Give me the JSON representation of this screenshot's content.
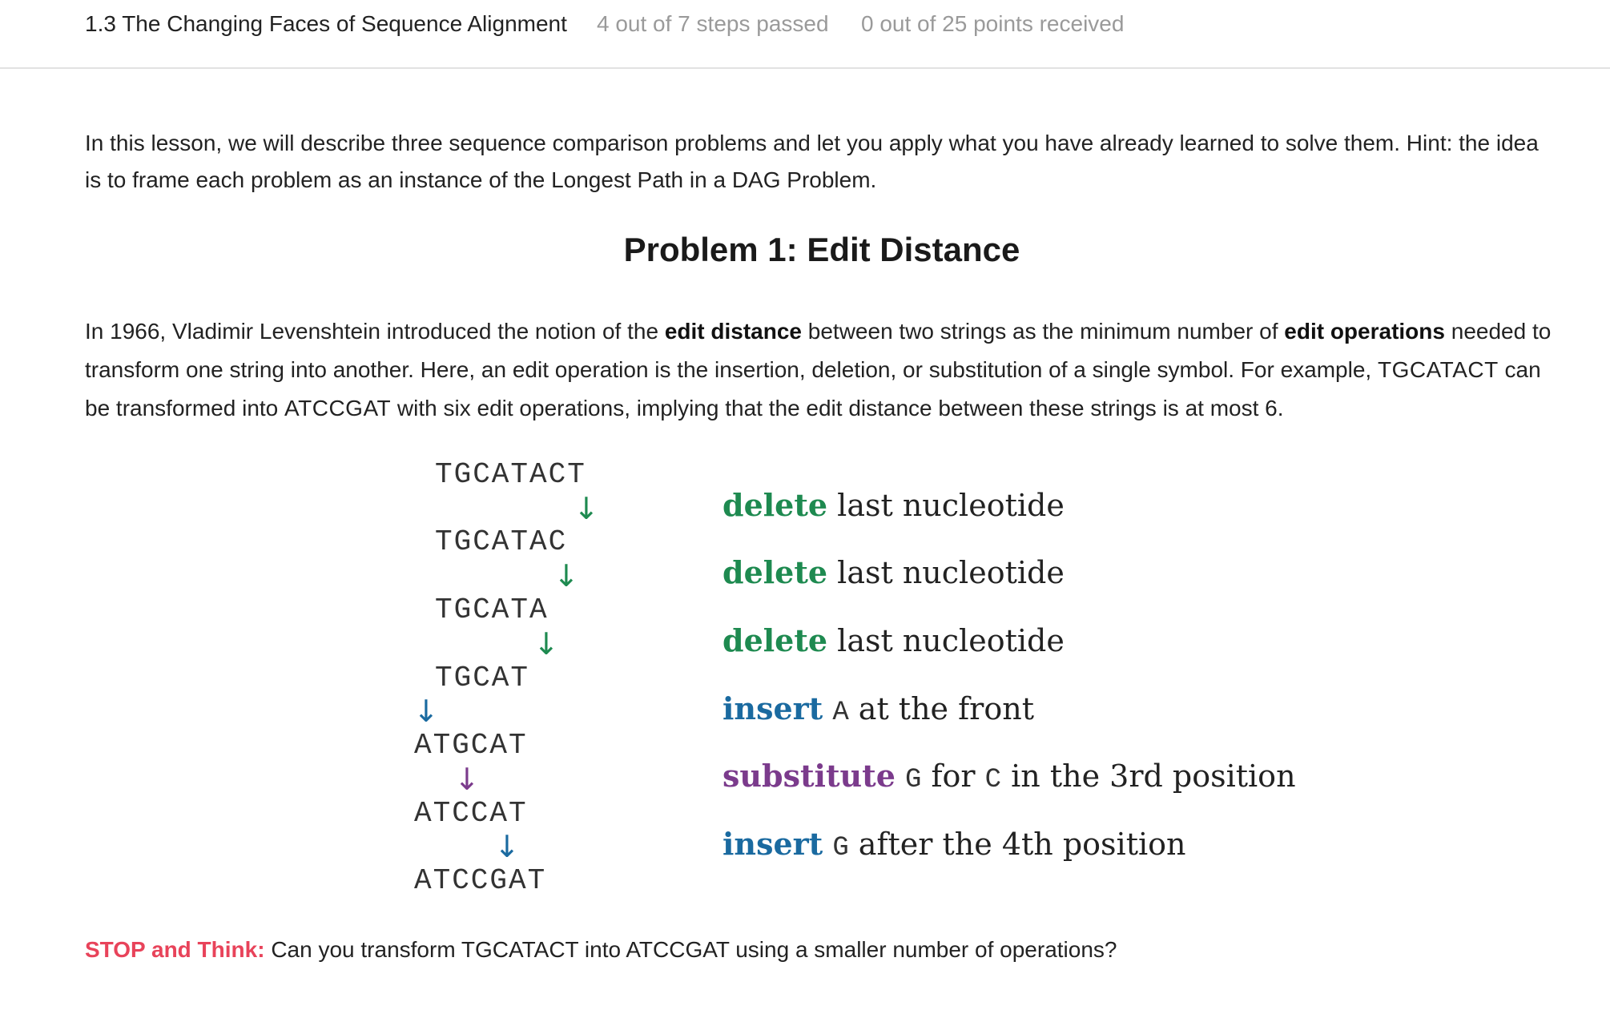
{
  "header": {
    "lesson_title": "1.3 The Changing Faces of Sequence Alignment",
    "steps_passed": "4 out of 7 steps passed",
    "points_received": "0 out of 25 points  received"
  },
  "intro": {
    "text": "In this lesson, we will describe three sequence comparison problems and let you apply what you have already learned to solve them. Hint: the idea is to frame each problem as an instance of the Longest Path in a DAG Problem."
  },
  "problem": {
    "heading": "Problem 1: Edit Distance",
    "p_part1": "In 1966, Vladimir Levenshtein introduced the notion of the ",
    "p_bold1": "edit distance",
    "p_part2": " between two strings as the minimum number of ",
    "p_bold2": "edit operations",
    "p_part3": " needed to transform one string into another. Here, an edit operation is the insertion, deletion, or substitution of a single symbol. For example, ",
    "p_seq1": "TGCATACT",
    "p_part4": " can be transformed into ",
    "p_seq2": "ATCCGAT",
    "p_part5": " with six edit operations, implying that the edit distance between these strings is at most 6."
  },
  "figure": {
    "sequences": [
      "TGCATACT",
      "TGCATAC",
      "TGCATA",
      "TGCAT",
      "ATGCAT",
      "ATCCAT",
      "ATCCGAT"
    ],
    "arrow_glyph": "↓",
    "operations": [
      {
        "verb": "delete",
        "color": "#1e8a50",
        "rest": " last nucleotide"
      },
      {
        "verb": "delete",
        "color": "#1e8a50",
        "rest": " last nucleotide"
      },
      {
        "verb": "delete",
        "color": "#1e8a50",
        "rest": " last nucleotide"
      },
      {
        "verb": "insert",
        "color": "#1a6aa0",
        "nuc1": "A",
        "rest": " at the front"
      },
      {
        "verb": "substitute",
        "color": "#7b3b8c",
        "nuc1": "G",
        "mid": " for ",
        "nuc2": "C",
        "rest": " in the 3rd position"
      },
      {
        "verb": "insert",
        "color": "#1a6aa0",
        "nuc1": "G",
        "rest": " after the 4th position"
      }
    ]
  },
  "stop": {
    "label": "STOP and Think:",
    "q_part1": " Can you transform ",
    "q_seq1": "TGCATACT",
    "q_part2": " into ",
    "q_seq2": "ATCCGAT",
    "q_part3": " using a smaller number of operations?"
  },
  "colors": {
    "delete": "#1e8a50",
    "insert": "#1a6aa0",
    "substitute": "#7b3b8c",
    "stop_label": "#e8435a",
    "meta_gray": "#9a9a9a"
  }
}
